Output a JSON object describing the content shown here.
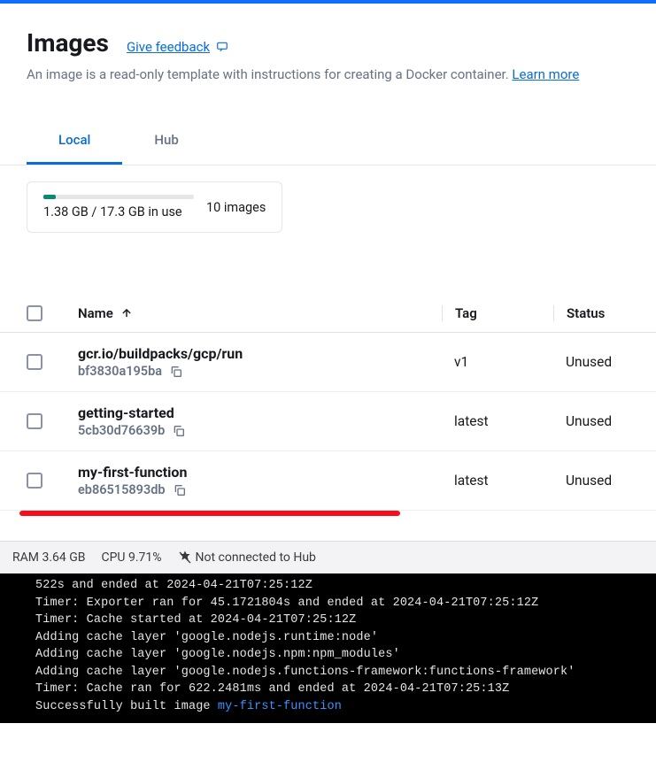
{
  "header": {
    "title": "Images",
    "feedback": "Give feedback",
    "subtitle": "An image is a read-only template with instructions for creating a Docker container.",
    "learn_more": "Learn more"
  },
  "tabs": [
    {
      "label": "Local",
      "active": true
    },
    {
      "label": "Hub",
      "active": false
    }
  ],
  "storage": {
    "used": "1.38 GB",
    "total": "17.3 GB",
    "text": "1.38 GB / 17.3 GB in use",
    "count": "10 images",
    "percent": 8
  },
  "table": {
    "headers": {
      "name": "Name",
      "tag": "Tag",
      "status": "Status"
    },
    "rows": [
      {
        "name": "gcr.io/buildpacks/gcp/run",
        "hash": "bf3830a195ba",
        "tag": "v1",
        "status": "Unused"
      },
      {
        "name": "getting-started",
        "hash": "5cb30d76639b",
        "tag": "latest",
        "status": "Unused"
      },
      {
        "name": "my-first-function",
        "hash": "eb86515893db",
        "tag": "latest",
        "status": "Unused"
      }
    ]
  },
  "status_bar": {
    "ram": "RAM 3.64 GB",
    "cpu": "CPU 9.71%",
    "hub": "Not connected to Hub"
  },
  "terminal": {
    "lines": [
      "522s and ended at 2024-04-21T07:25:12Z",
      "Timer: Exporter ran for 45.1721804s and ended at 2024-04-21T07:25:12Z",
      "Timer: Cache started at 2024-04-21T07:25:12Z",
      "Adding cache layer 'google.nodejs.runtime:node'",
      "Adding cache layer 'google.nodejs.npm:npm_modules'",
      "Adding cache layer 'google.nodejs.functions-framework:functions-framework'",
      "Timer: Cache ran for 622.2481ms and ended at 2024-04-21T07:25:13Z"
    ],
    "success_prefix": "Successfully built image ",
    "success_highlight": "my-first-function"
  }
}
